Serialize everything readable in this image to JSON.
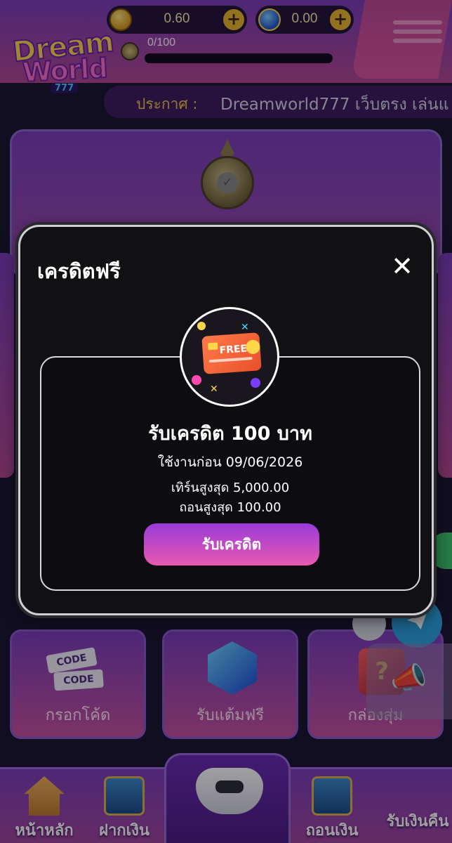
{
  "header": {
    "logo_text": {
      "line1": "Dream",
      "line2": "World",
      "line3": "777"
    },
    "coin_balance": "0.60",
    "gem_balance": "0.00",
    "level_progress": "0/100",
    "level_fraction": 0.0,
    "add_symbol": "+"
  },
  "announcement": {
    "label": "ประกาศ :",
    "text": "Dreamworld777 เว็บตรง เล่นแ"
  },
  "modal": {
    "title": "เครดิตฟรี",
    "close_symbol": "✕",
    "reward_card_text": "FREE",
    "credit_title": "รับเครดิต 100 บาท",
    "expire_text": "ใช้งานก่อน 09/06/2026",
    "turnover_text": "เทิร์นสูงสุด 5,000.00",
    "max_withdraw_text": "ถอนสูงสุด 100.00",
    "claim_button": "รับเครดิต"
  },
  "tiles": {
    "code": {
      "label": "กรอกโค้ด",
      "card_text": "CODE"
    },
    "free_points": {
      "label": "รับแต้มฟรี"
    },
    "random_box": {
      "label": "กล่องสุ่ม",
      "box_symbol": "?"
    }
  },
  "bottom_nav": {
    "home": "หน้าหลัก",
    "deposit": "ฝากเงิน",
    "withdraw": "ถอนเงิน",
    "cashback": "รับเงินคืน"
  },
  "colors": {
    "brand_purple": "#7a3cb8",
    "brand_pink": "#c4509c",
    "accent_gold": "#e8b52a",
    "claim_gradient_top": "#9a3ad8",
    "claim_gradient_bottom": "#e85ab0"
  },
  "icons": {
    "coin": "coin-icon",
    "gem": "gem-icon",
    "level": "level-badge-icon",
    "menu": "hamburger-menu-icon",
    "close": "close-icon",
    "credit_card": "free-credit-card-icon",
    "home": "house-icon",
    "deposit": "atm-deposit-icon",
    "withdraw": "atm-withdraw-icon",
    "game": "gamepad-icon",
    "telegram": "telegram-icon",
    "promo": "megaphone-icon"
  }
}
